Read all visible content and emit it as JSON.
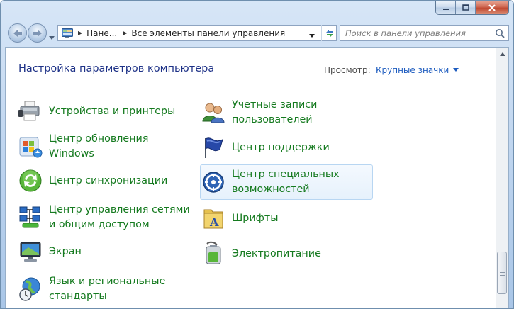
{
  "address": {
    "crumbs": [
      "Пане...",
      "Все элементы панели управления"
    ]
  },
  "search": {
    "placeholder": "Поиск в панели управления"
  },
  "header": {
    "title": "Настройка параметров компьютера",
    "view_label": "Просмотр:",
    "view_value": "Крупные значки"
  },
  "items": {
    "devices": [
      "Устройства и принтеры"
    ],
    "update": [
      "Центр обновления",
      "Windows"
    ],
    "sync": [
      "Центр синхронизации"
    ],
    "network": [
      "Центр управления сетями",
      "и общим доступом"
    ],
    "display": [
      "Экран"
    ],
    "region": [
      "Язык и региональные",
      "стандарты"
    ],
    "accounts": [
      "Учетные записи",
      "пользователей"
    ],
    "support": [
      "Центр поддержки"
    ],
    "ease": [
      "Центр специальных",
      "возможностей"
    ],
    "fonts": [
      "Шрифты"
    ],
    "power": [
      "Электропитание"
    ]
  },
  "icons": {
    "devices": "printer-icon",
    "update": "windows-update-icon",
    "sync": "sync-icon",
    "network": "network-icon",
    "display": "monitor-icon",
    "region": "globe-clock-icon",
    "accounts": "users-icon",
    "support": "flag-icon",
    "ease": "ease-of-access-icon",
    "fonts": "fonts-icon",
    "power": "battery-icon"
  },
  "colors": {
    "title": "#1e3287",
    "link": "#157a1f",
    "view_link": "#1e5cbf"
  }
}
